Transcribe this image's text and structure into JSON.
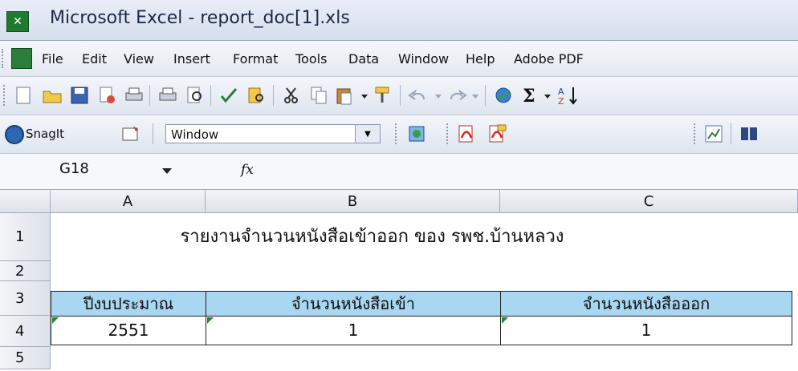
{
  "window": {
    "title": "Microsoft Excel - report_doc[1].xls",
    "app_icon": "excel-icon"
  },
  "menu": [
    "File",
    "Edit",
    "View",
    "Insert",
    "Format",
    "Tools",
    "Data",
    "Window",
    "Help",
    "Adobe PDF"
  ],
  "toolbar2": {
    "snagit_label": "SnagIt",
    "capture_mode": "Window"
  },
  "formula_bar": {
    "name_box": "G18",
    "fx_symbol": "fx"
  },
  "columns": [
    "A",
    "B",
    "C"
  ],
  "rows": [
    "1",
    "2",
    "3",
    "4",
    "5"
  ],
  "sheet": {
    "title": "รายงานจำนวนหนังสือเข้าออก ของ รพช.บ้านหลวง",
    "headers": [
      "ปีงบประมาณ",
      "จำนวนหนังสือเข้า",
      "จำนวนหนังสือออก"
    ],
    "data_row": [
      "2551",
      "1",
      "1"
    ]
  },
  "colors": {
    "header_fill": "#a9d6f0",
    "error_triangle": "#1d8a2d"
  }
}
